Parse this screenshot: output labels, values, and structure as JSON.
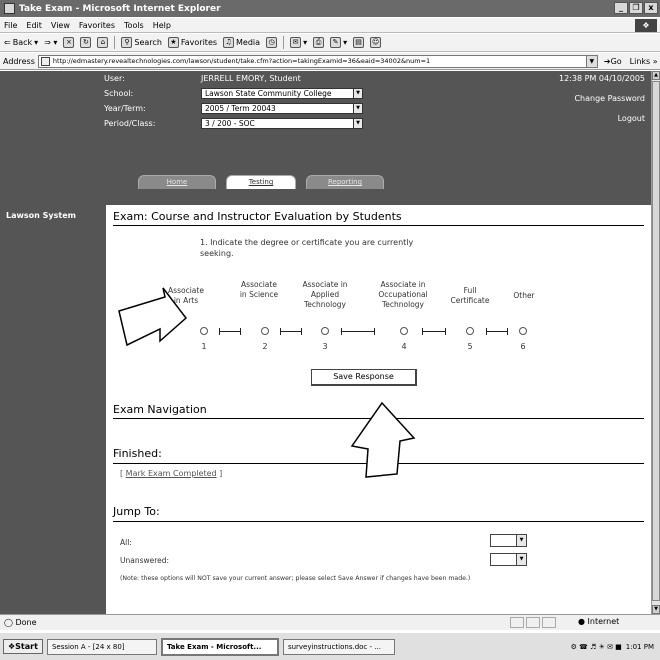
{
  "window": {
    "title": "Take Exam - Microsoft Internet Explorer",
    "controls": [
      "_",
      "ő",
      "x"
    ]
  },
  "menu": [
    "File",
    "Edit",
    "View",
    "Favorites",
    "Tools",
    "Help"
  ],
  "toolbar": {
    "back": "Back",
    "search": "Search",
    "favorites": "Favorites",
    "media": "Media"
  },
  "address": {
    "label": "Address",
    "url": "http://edmastery.revealtechnologies.com/lawson/student/take.cfm?action=takingExamid=36&eaid=34002&num=1",
    "go": "Go",
    "links": "Links"
  },
  "header": {
    "user_label": "User:",
    "user_value": "JERRELL EMORY, Student",
    "school_label": "School:",
    "school_value": "Lawson State Community College",
    "term_label": "Year/Term:",
    "term_value": "2005 / Term 20043",
    "class_label": "Period/Class:",
    "class_value": "3 / 200 - SOC",
    "datetime": "12:38 PM 04/10/2005",
    "change_password": "Change Password",
    "logout": "Logout"
  },
  "tabs": [
    "Home",
    "Testing",
    "Reporting"
  ],
  "sidebar": {
    "system": "Lawson System"
  },
  "exam": {
    "title": "Exam: Course and Instructor Evaluation by Students",
    "question": "1. Indicate the degree or certificate you are currently seeking.",
    "options": [
      {
        "label": "Associate in Arts",
        "num": "1"
      },
      {
        "label": "Associate in Science",
        "num": "2"
      },
      {
        "label": "Associate in Applied Technology",
        "num": "3"
      },
      {
        "label": "Associate in Occupational Technology",
        "num": "4"
      },
      {
        "label": "Full Certificate",
        "num": "5"
      },
      {
        "label": "Other",
        "num": "6"
      }
    ],
    "save_button": "Save Response",
    "nav_title": "Exam Navigation",
    "finished_title": "Finished:",
    "mark_completed": "Mark Exam Completed",
    "jump_title": "Jump To:",
    "jump_all": "All:",
    "jump_unanswered": "Unanswered:",
    "note": "(Note: these options will NOT save your current answer; please select Save Answer if changes have been made.)"
  },
  "status": {
    "text": "Done",
    "zone": "Internet"
  },
  "taskbar": {
    "start": "Start",
    "tasks": [
      "Session A - [24 x 80]",
      "Take Exam - Microsoft...",
      "surveyinstructions.doc - ..."
    ],
    "clock": "1:01 PM"
  }
}
